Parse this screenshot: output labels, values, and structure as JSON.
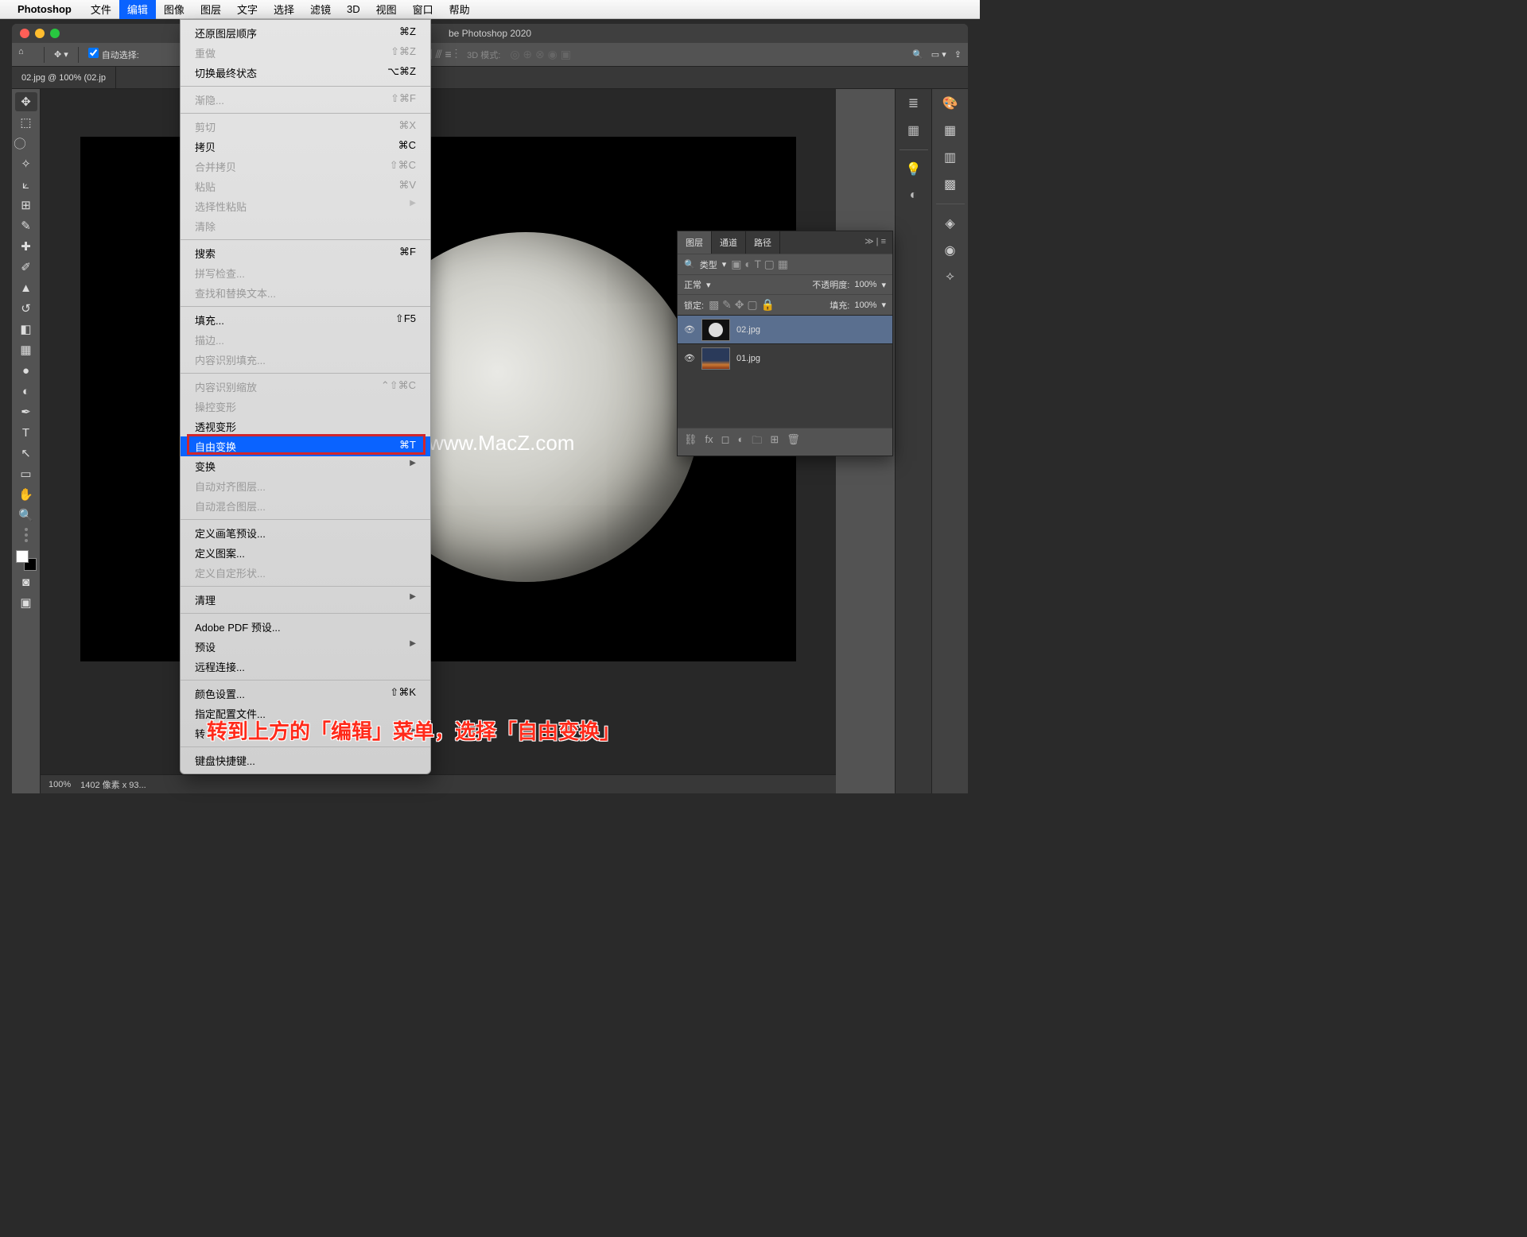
{
  "menubar": {
    "app": "Photoshop",
    "items": [
      "文件",
      "编辑",
      "图像",
      "图层",
      "文字",
      "选择",
      "滤镜",
      "3D",
      "视图",
      "窗口",
      "帮助"
    ],
    "active_index": 1
  },
  "window": {
    "title": "be Photoshop 2020"
  },
  "optionbar": {
    "auto_select_label": "自动选择:",
    "mode_3d": "3D 模式:"
  },
  "tab": {
    "label": "02.jpg @ 100% (02.jp"
  },
  "status": {
    "zoom": "100%",
    "info": "1402 像素 x 93..."
  },
  "watermark": "www.MacZ.com",
  "layers_panel": {
    "tabs": [
      "图层",
      "通道",
      "路径"
    ],
    "kind_label": "类型",
    "blend_label": "正常",
    "opacity_label": "不透明度:",
    "opacity_value": "100%",
    "lock_label": "锁定:",
    "fill_label": "填充:",
    "fill_value": "100%",
    "layers": [
      {
        "name": "02.jpg",
        "selected": true,
        "thumb": "moon"
      },
      {
        "name": "01.jpg",
        "selected": false,
        "thumb": "sky"
      }
    ]
  },
  "edit_menu": [
    {
      "label": "还原图层顺序",
      "shortcut": "⌘Z"
    },
    {
      "label": "重做",
      "shortcut": "⇧⌘Z",
      "disabled": true
    },
    {
      "label": "切换最终状态",
      "shortcut": "⌥⌘Z"
    },
    {
      "sep": true
    },
    {
      "label": "渐隐...",
      "shortcut": "⇧⌘F",
      "disabled": true
    },
    {
      "sep": true
    },
    {
      "label": "剪切",
      "shortcut": "⌘X",
      "disabled": true
    },
    {
      "label": "拷贝",
      "shortcut": "⌘C"
    },
    {
      "label": "合并拷贝",
      "shortcut": "⇧⌘C",
      "disabled": true
    },
    {
      "label": "粘贴",
      "shortcut": "⌘V",
      "disabled": true
    },
    {
      "label": "选择性粘贴",
      "sub": true,
      "disabled": true
    },
    {
      "label": "清除",
      "disabled": true
    },
    {
      "sep": true
    },
    {
      "label": "搜索",
      "shortcut": "⌘F"
    },
    {
      "label": "拼写检查...",
      "disabled": true
    },
    {
      "label": "查找和替换文本...",
      "disabled": true
    },
    {
      "sep": true
    },
    {
      "label": "填充...",
      "shortcut": "⇧F5"
    },
    {
      "label": "描边...",
      "disabled": true
    },
    {
      "label": "内容识别填充...",
      "disabled": true
    },
    {
      "sep": true
    },
    {
      "label": "内容识别缩放",
      "shortcut": "⌃⇧⌘C",
      "disabled": true
    },
    {
      "label": "操控变形",
      "disabled": true
    },
    {
      "label": "透视变形"
    },
    {
      "label": "自由变换",
      "shortcut": "⌘T",
      "highlight": true
    },
    {
      "label": "变换",
      "sub": true
    },
    {
      "label": "自动对齐图层...",
      "disabled": true
    },
    {
      "label": "自动混合图层...",
      "disabled": true
    },
    {
      "sep": true
    },
    {
      "label": "定义画笔预设..."
    },
    {
      "label": "定义图案..."
    },
    {
      "label": "定义自定形状...",
      "disabled": true
    },
    {
      "sep": true
    },
    {
      "label": "清理",
      "sub": true
    },
    {
      "sep": true
    },
    {
      "label": "Adobe PDF 预设..."
    },
    {
      "label": "预设",
      "sub": true
    },
    {
      "label": "远程连接..."
    },
    {
      "sep": true
    },
    {
      "label": "颜色设置...",
      "shortcut": "⇧⌘K"
    },
    {
      "label": "指定配置文件..."
    },
    {
      "label": "转",
      "sub": true
    },
    {
      "sep": true
    },
    {
      "label": "键盘快捷键..."
    }
  ],
  "annotation": "转到上方的「编辑」菜单，选择「自由变换」"
}
